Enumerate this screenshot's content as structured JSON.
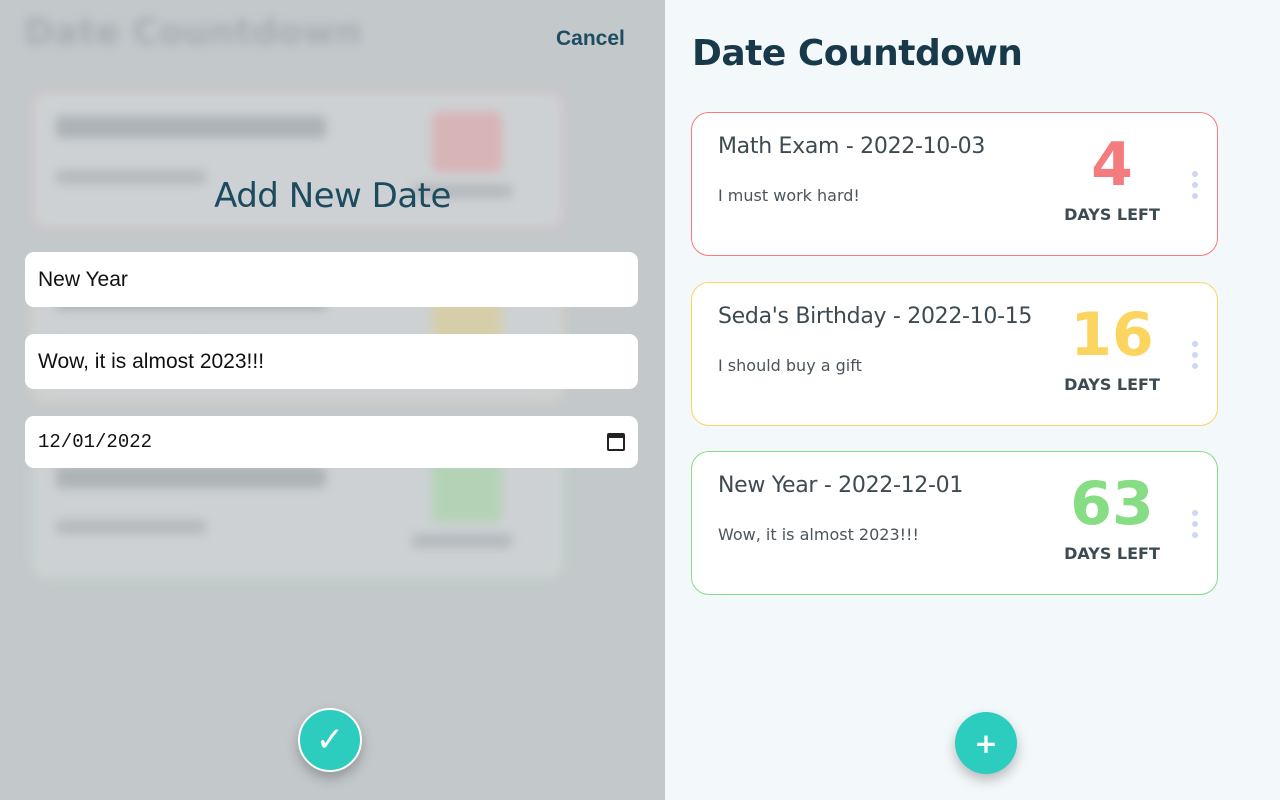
{
  "app": {
    "title": "Date Countdown"
  },
  "form": {
    "cancel_label": "Cancel",
    "title": "Add New Date",
    "name_value": "New Year",
    "note_value": "Wow, it is almost 2023!!!",
    "date_value": "12/01/2022",
    "submit_icon": "✓"
  },
  "add_button": {
    "icon": "+"
  },
  "events": [
    {
      "title": "Math Exam - 2022-10-03",
      "note": "I must work hard!",
      "days": "4",
      "days_label": "DAYS LEFT",
      "color": "#f47c7e"
    },
    {
      "title": "Seda's Birthday - 2022-10-15",
      "note": "I should buy a gift",
      "days": "16",
      "days_label": "DAYS LEFT",
      "color": "#fbd560"
    },
    {
      "title": "New Year - 2022-12-01",
      "note": "Wow, it is almost 2023!!!",
      "days": "63",
      "days_label": "DAYS LEFT",
      "color": "#86dd83"
    }
  ],
  "colors": {
    "accent": "#2ccdbf",
    "title": "#17394a",
    "overlay": "#c3c8cb"
  }
}
